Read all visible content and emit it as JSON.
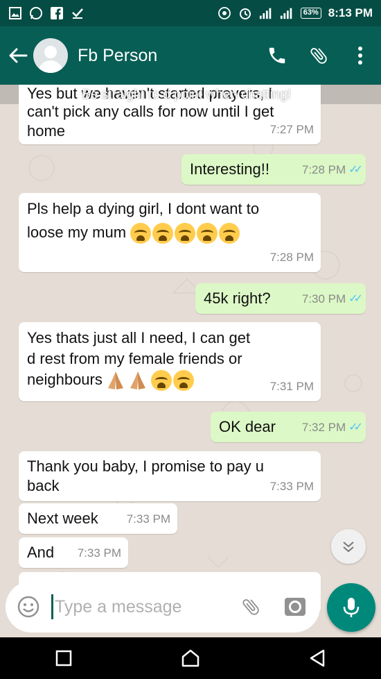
{
  "status_bar": {
    "battery": "63%",
    "time": "8:13 PM"
  },
  "header": {
    "contact_name": "Fb Person"
  },
  "overlay": "Be straight to d point when chatting!",
  "messages": [
    {
      "dir": "in",
      "line1": "Yes but we haven't started prayers, I",
      "line2": "can't pick any calls for now until I get",
      "line3": "home",
      "time": "7:27 PM"
    },
    {
      "dir": "out",
      "text": "Interesting!!",
      "time": "7:28 PM"
    },
    {
      "dir": "in",
      "line1": "Pls help a dying girl, I dont want to",
      "line2": "loose my mum",
      "time": "7:28 PM"
    },
    {
      "dir": "out",
      "text": "45k right?",
      "time": "7:30 PM"
    },
    {
      "dir": "in",
      "line1": "Yes thats just all I need, I can get",
      "line2": "d rest from my female friends or",
      "line3": "neighbours",
      "time": "7:31 PM"
    },
    {
      "dir": "out",
      "text": "OK dear",
      "time": "7:32 PM"
    },
    {
      "dir": "in",
      "line1": "Thank you baby, I promise to pay u",
      "line2": "back",
      "time": "7:33 PM"
    },
    {
      "dir": "in",
      "text": "Next week",
      "time": "7:33 PM"
    },
    {
      "dir": "in",
      "text": "And",
      "time": "7:33 PM"
    }
  ],
  "input": {
    "placeholder": "Type a message"
  },
  "colors": {
    "header": "#075e54",
    "outgoing": "#dcf8c6",
    "incoming": "#ffffff",
    "accent": "#00897b"
  },
  "icons": [
    "back-arrow-icon",
    "avatar",
    "phone-icon",
    "attach-icon",
    "more-icon",
    "emoji-icon",
    "camera-icon",
    "mic-icon",
    "scroll-down-icon"
  ]
}
